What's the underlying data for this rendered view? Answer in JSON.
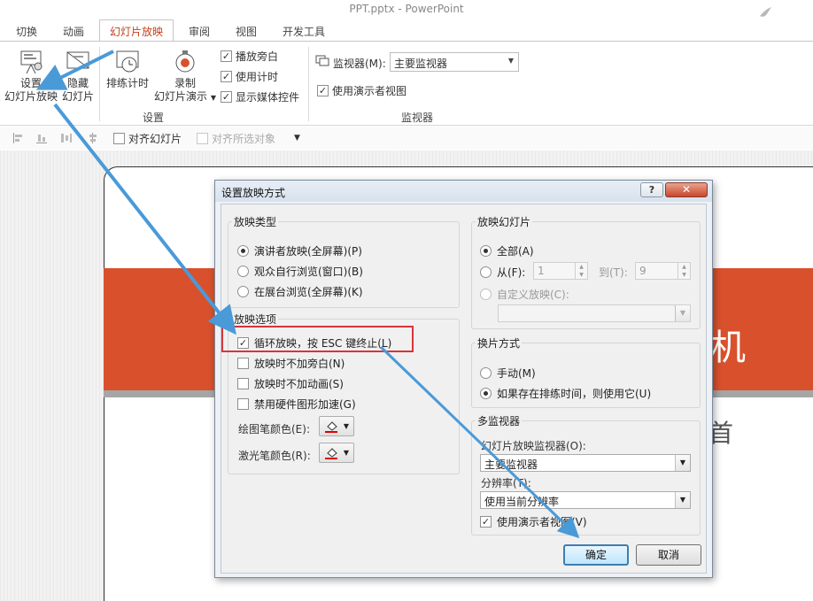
{
  "window": {
    "title": "PPT.pptx - PowerPoint"
  },
  "ribbon_tabs": [
    "切换",
    "动画",
    "幻灯片放映",
    "审阅",
    "视图",
    "开发工具"
  ],
  "ribbon": {
    "setup_line1": "设置",
    "setup_line2": "幻灯片放映",
    "hide_line1": "隐藏",
    "hide_line2": "幻灯片",
    "rehearse": "排练计时",
    "record_line1": "录制",
    "record_line2": "幻灯片演示",
    "cb_narration": "播放旁白",
    "cb_timing": "使用计时",
    "cb_media": "显示媒体控件",
    "group_setup": "设置",
    "monitor_label": "监视器(M):",
    "monitor_value": "主要监视器",
    "presenter_view": "使用演示者视图",
    "group_monitor": "监视器"
  },
  "quickbar": {
    "align_slides": "对齐幻灯片",
    "align_selected": "对齐所选对象"
  },
  "slide": {
    "text1": "机",
    "text2": "首"
  },
  "dialog": {
    "title": "设置放映方式",
    "help": "?",
    "close": "✕",
    "show_type": {
      "legend": "放映类型",
      "options": [
        "演讲者放映(全屏幕)(P)",
        "观众自行浏览(窗口)(B)",
        "在展台浏览(全屏幕)(K)"
      ],
      "selected_index": 0
    },
    "show_options": {
      "legend": "放映选项",
      "loop": "循环放映，按 ESC 键终止(L)",
      "no_narration": "放映时不加旁白(N)",
      "no_animation": "放映时不加动画(S)",
      "disable_hw": "禁用硬件图形加速(G)",
      "pen_color": "绘图笔颜色(E):",
      "laser_color": "激光笔颜色(R):"
    },
    "show_slides": {
      "legend": "放映幻灯片",
      "all": "全部(A)",
      "from": "从(F):",
      "from_value": "1",
      "to": "到(T):",
      "to_value": "9",
      "custom": "自定义放映(C):"
    },
    "advance": {
      "legend": "换片方式",
      "manual": "手动(M)",
      "use_timings": "如果存在排练时间，则使用它(U)"
    },
    "multi_monitor": {
      "legend": "多监视器",
      "monitor_label": "幻灯片放映监视器(O):",
      "monitor_value": "主要监视器",
      "resolution_label": "分辨率(T):",
      "resolution_value": "使用当前分辨率",
      "presenter_view": "使用演示者视图(V)"
    },
    "ok": "确定",
    "cancel": "取消"
  },
  "colors": {
    "accent": "#c43e1c",
    "slide_band": "#d9512c",
    "annotation_arrow": "#4a9ad8",
    "highlight": "#d9343a"
  }
}
